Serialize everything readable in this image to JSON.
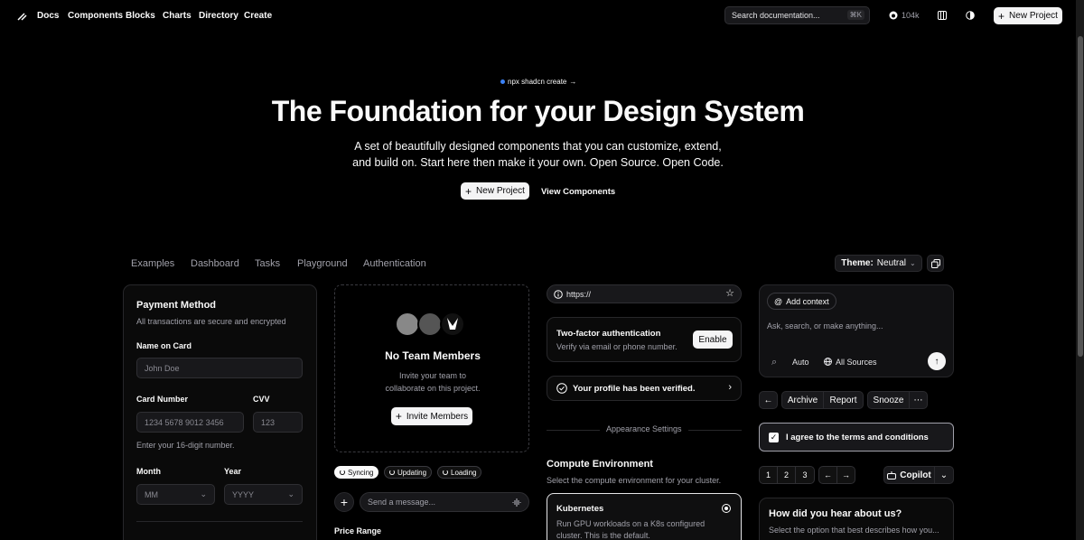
{
  "nav": {
    "links": [
      "Docs",
      "Components",
      "Blocks",
      "Charts",
      "Directory",
      "Create"
    ],
    "search_placeholder": "Search documentation...",
    "search_shortcut": "⌘K",
    "github_stars": "104k",
    "new_project": "New Project"
  },
  "hero": {
    "badge": "npx shadcn create",
    "badge_arrow": "→",
    "title": "The Foundation for your Design System",
    "subtitle_line1": "A set of beautifully designed components that you can customize, extend,",
    "subtitle_line2": "and build on. Start here then make it your own. Open Source. Open Code.",
    "primary_cta": "New Project",
    "secondary_cta": "View Components"
  },
  "tabs": [
    "Examples",
    "Dashboard",
    "Tasks",
    "Playground",
    "Authentication"
  ],
  "theme": {
    "label": "Theme:",
    "value": "Neutral"
  },
  "payment": {
    "title": "Payment Method",
    "subtitle": "All transactions are secure and encrypted",
    "name_label": "Name on Card",
    "name_placeholder": "John Doe",
    "card_label": "Card Number",
    "card_placeholder": "1234 5678 9012 3456",
    "cvv_label": "CVV",
    "cvv_placeholder": "123",
    "card_hint": "Enter your 16-digit number.",
    "month_label": "Month",
    "month_value": "MM",
    "year_label": "Year",
    "year_value": "YYYY"
  },
  "team": {
    "title": "No Team Members",
    "desc_line1": "Invite your team to",
    "desc_line2": "collaborate on this project.",
    "invite": "Invite Members"
  },
  "status_pills": [
    "Syncing",
    "Updating",
    "Loading"
  ],
  "message": {
    "placeholder": "Send a message..."
  },
  "price_range": "Price Range",
  "url_field": {
    "value": "https://"
  },
  "twofa": {
    "title": "Two-factor authentication",
    "desc": "Verify via email or phone number.",
    "button": "Enable"
  },
  "verified": "Your profile has been verified.",
  "appearance": "Appearance Settings",
  "compute": {
    "title": "Compute Environment",
    "subtitle": "Select the compute environment for your cluster.",
    "option_title": "Kubernetes",
    "option_desc_line1": "Run GPU workloads on a K8s configured",
    "option_desc_line2": "cluster. This is the default."
  },
  "ai": {
    "add_context": "Add context",
    "placeholder": "Ask, search, or make anything...",
    "mode": "Auto",
    "sources": "All Sources"
  },
  "actions": {
    "archive": "Archive",
    "report": "Report",
    "snooze": "Snooze"
  },
  "terms": "I agree to the terms and conditions",
  "pagination": [
    "1",
    "2",
    "3"
  ],
  "copilot": "Copilot",
  "survey": {
    "title": "How did you hear about us?",
    "subtitle": "Select the option that best describes how you..."
  }
}
